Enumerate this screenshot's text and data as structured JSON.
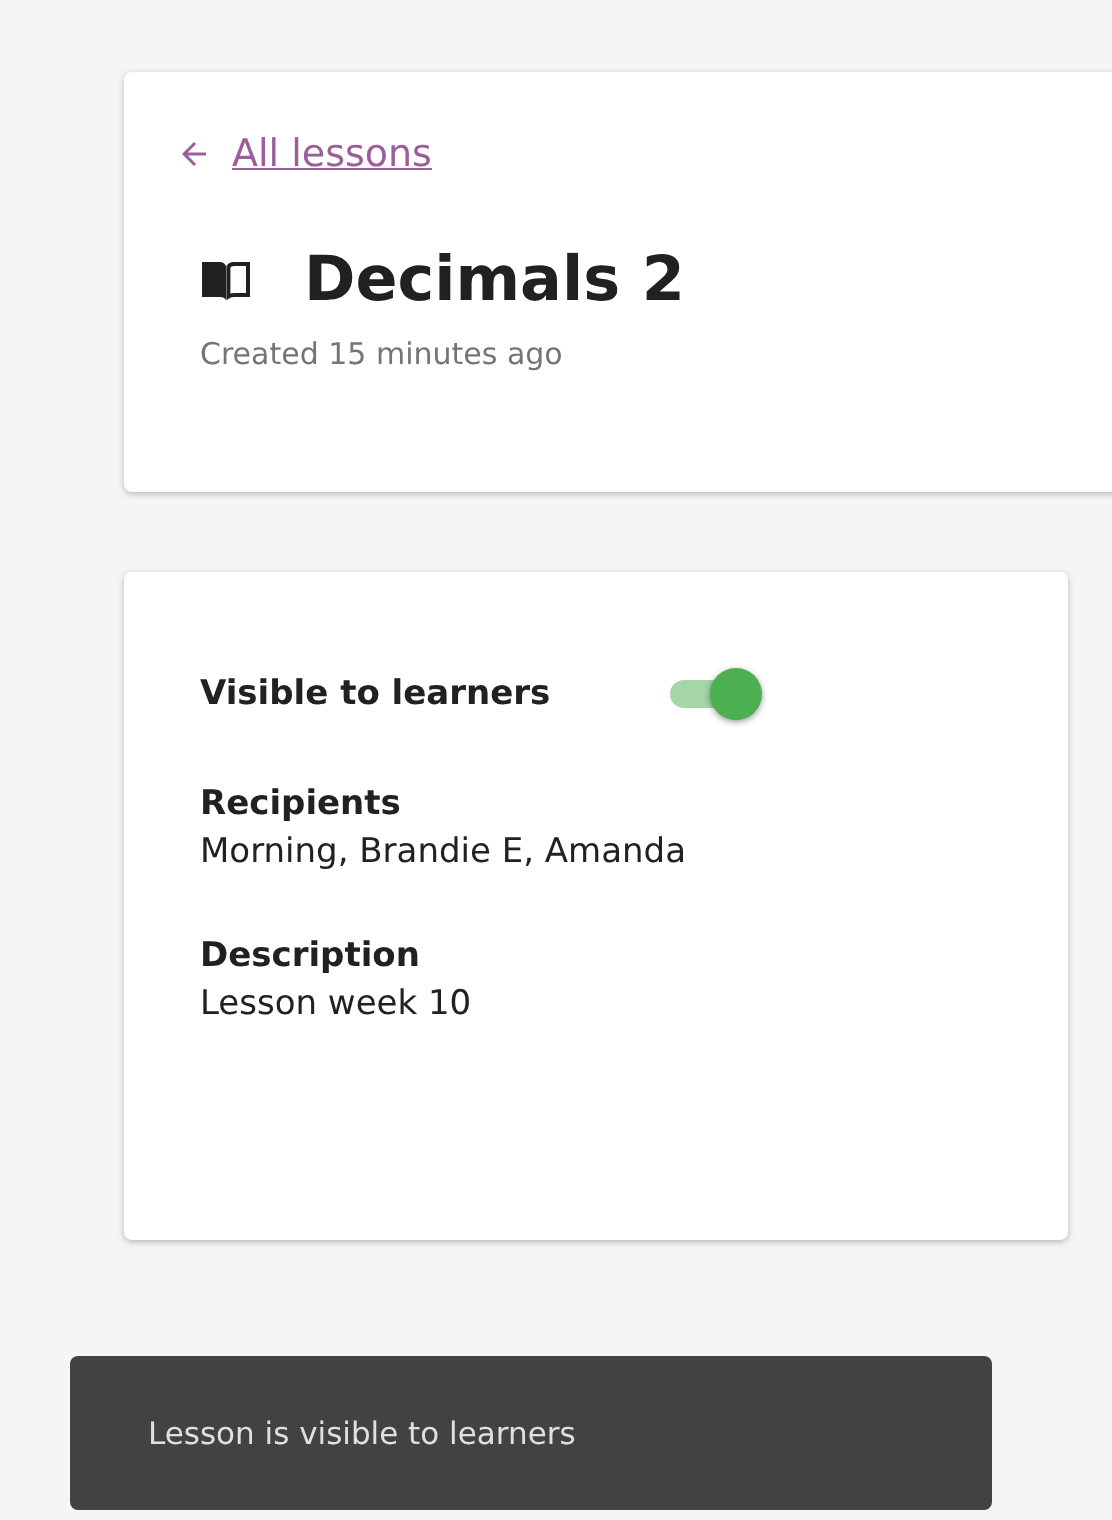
{
  "header": {
    "back_link": "All lessons",
    "title": "Decimals 2",
    "created": "Created 15 minutes ago"
  },
  "details": {
    "visibility": {
      "label": "Visible to learners",
      "on": true
    },
    "fields": [
      {
        "label": "Recipients",
        "value": "Morning, Brandie E, Amanda"
      },
      {
        "label": "Description",
        "value": "Lesson week 10"
      }
    ]
  },
  "snackbar": {
    "message": "Lesson is visible to learners"
  }
}
